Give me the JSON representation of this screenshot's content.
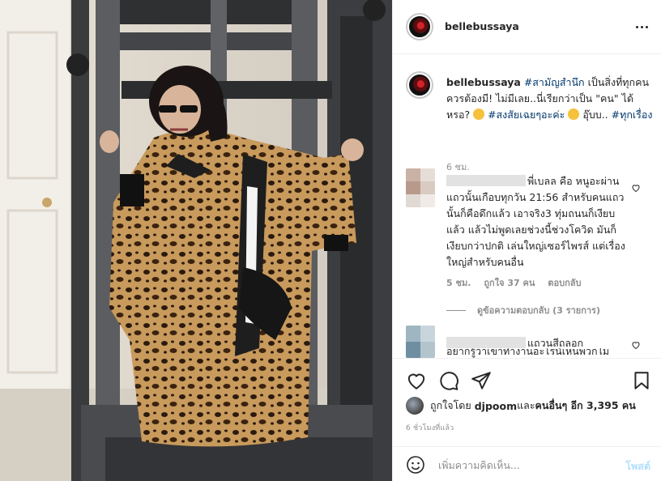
{
  "post": {
    "username": "bellebussaya",
    "caption": {
      "username": "bellebussaya",
      "tag1": "#สามัญสำนึก",
      "text1": " เป็นสิ่งที่ทุกคนควรต้องมี! ไม่มีเลย..นี่เรียกว่าเป็น \"คน\" ได้หรอ? ",
      "tag2": "#สงสัยเฉยๆอะค่ะ",
      "text2": " อุ๊บบ..",
      "tag3": "#ทุกเรื่อง",
      "time": "6 ชม."
    },
    "comments": [
      {
        "text": "พี่เบลล คือ หนูอะผ่านแถวนั้นเกือบทุกวัน 21:56 สำหรับคนแถวนั้นก็คือดึกแล้ว เอาจริง3 ทุ่มถนนก็เงียบแล้ว แล้วไม่พูดเลยช่วงนี้ช่วงโควิด มันก็เงียบกว่าปกติ เล่นใหญ่เซอร์ไพรส์ แต่เรื่องใหญ่สำหรับคนอื่น",
        "time": "5 ชม.",
        "likes": "ถูกใจ 37 คน",
        "reply": "ตอบกลับ"
      },
      {
        "text": "แถวนสีถลอก",
        "line2": "อยากรู้ว่าเขาทำงานอะไรนี่เห็นพวกไม่"
      }
    ],
    "view_replies": "ดูข้อความตอบกลับ (3 รายการ)",
    "likes": {
      "prefix": "ถูกใจโดย",
      "user": "djpoom",
      "middle": " และ ",
      "others": "คนอื่นๆ อีก 3,395 คน"
    },
    "time_ago": "6 ชั่วโมงที่แล้ว",
    "comment_input": {
      "placeholder": "เพิ่มความคิดเห็น..."
    },
    "post_label": "โพสต์"
  },
  "icons": {
    "more": "more-icon",
    "like": "heart-icon",
    "comment": "comment-icon",
    "share": "share-icon",
    "save": "bookmark-icon",
    "emoji": "emoji-icon"
  },
  "colors": {
    "link": "#00376b",
    "post_button": "#b2dffc",
    "muted": "#8e8e8e"
  }
}
